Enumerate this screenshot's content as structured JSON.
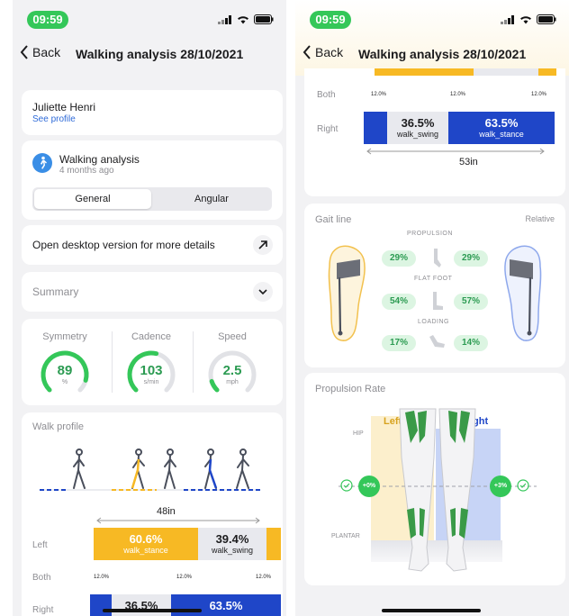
{
  "status": {
    "time": "09:59"
  },
  "nav": {
    "back_label": "Back",
    "title": "Walking analysis 28/10/2021"
  },
  "patient": {
    "name": "Juliette Henri",
    "link": "See profile"
  },
  "analysis": {
    "title": "Walking analysis",
    "ago": "4 months ago",
    "tabs": [
      "General",
      "Angular"
    ],
    "selected_tab": "General"
  },
  "desktop": {
    "label": "Open desktop version for more details"
  },
  "summary": {
    "label": "Summary"
  },
  "metrics": [
    {
      "name": "Symmetry",
      "value": "89",
      "unit": "%",
      "progress": 0.89
    },
    {
      "name": "Cadence",
      "value": "103",
      "unit": "s/min",
      "progress": 0.55
    },
    {
      "name": "Speed",
      "value": "2.5",
      "unit": "mph",
      "progress": 0.1
    }
  ],
  "walk_profile": {
    "title": "Walk profile",
    "left_stride": "48in",
    "right_stride": "53in",
    "left": {
      "label": "Left",
      "stance_pct": "60.6%",
      "stance_name": "walk_stance",
      "swing_pct": "39.4%",
      "swing_name": "walk_swing"
    },
    "both": {
      "label": "Both",
      "vals": [
        "12.0%",
        "12.0%",
        "12.0%"
      ]
    },
    "right": {
      "label": "Right",
      "swing_pct": "36.5%",
      "swing_name": "walk_swing",
      "stance_pct": "63.5%",
      "stance_name": "walk_stance"
    }
  },
  "gait": {
    "title": "Gait line",
    "mode": "Relative",
    "rows": [
      {
        "label": "PROPULSION",
        "left": "29%",
        "right": "29%"
      },
      {
        "label": "FLAT FOOT",
        "left": "54%",
        "right": "57%"
      },
      {
        "label": "LOADING",
        "left": "17%",
        "right": "14%"
      }
    ]
  },
  "propulsion": {
    "title": "Propulsion Rate",
    "left_label": "Left",
    "right_label": "Right",
    "hip": "HIP",
    "plantar": "PLANTAR",
    "left_value": "+0%",
    "right_value": "+3%"
  },
  "colors": {
    "stance_left": "#f7b924",
    "stance_right": "#1f46c8",
    "swing": "#e8e9ee",
    "accent_green": "#34c759",
    "left_zone": "#fcefcc",
    "right_zone": "#c7d4f6"
  }
}
